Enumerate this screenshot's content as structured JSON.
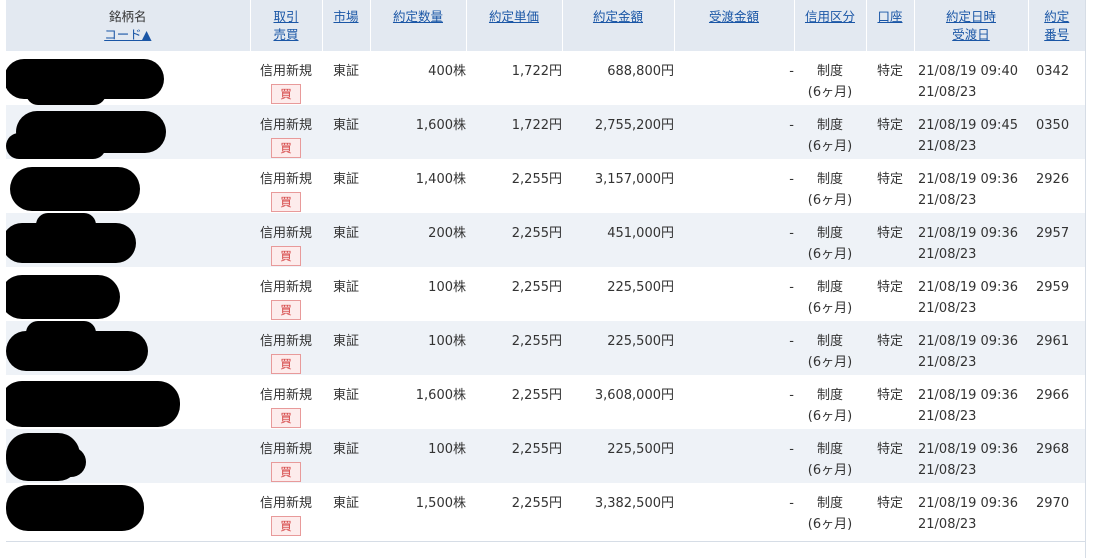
{
  "header": {
    "stock_name": "銘柄名",
    "code_sort": "コード▲",
    "trade_type_1": "取引",
    "trade_type_2": "売買",
    "market": "市場",
    "quantity": "約定数量",
    "unit_price": "約定単価",
    "amount": "約定金額",
    "settlement_amount": "受渡金額",
    "margin_type": "信用区分",
    "account": "口座",
    "datetime_1": "約定日時",
    "datetime_2": "受渡日",
    "order_no_1": "約定",
    "order_no_2": "番号"
  },
  "rows": [
    {
      "trade": "信用新規",
      "side": "買",
      "market": "東証",
      "qty": "400株",
      "price": "1,722円",
      "amount": "688,800円",
      "settle": "-",
      "margin_1": "制度",
      "margin_2": "(6ヶ月)",
      "account": "特定",
      "exec": "21/08/19 09:40",
      "delivery": "21/08/23",
      "no": "0342"
    },
    {
      "trade": "信用新規",
      "side": "買",
      "market": "東証",
      "qty": "1,600株",
      "price": "1,722円",
      "amount": "2,755,200円",
      "settle": "-",
      "margin_1": "制度",
      "margin_2": "(6ヶ月)",
      "account": "特定",
      "exec": "21/08/19 09:45",
      "delivery": "21/08/23",
      "no": "0350"
    },
    {
      "trade": "信用新規",
      "side": "買",
      "market": "東証",
      "qty": "1,400株",
      "price": "2,255円",
      "amount": "3,157,000円",
      "settle": "-",
      "margin_1": "制度",
      "margin_2": "(6ヶ月)",
      "account": "特定",
      "exec": "21/08/19 09:36",
      "delivery": "21/08/23",
      "no": "2926"
    },
    {
      "trade": "信用新規",
      "side": "買",
      "market": "東証",
      "qty": "200株",
      "price": "2,255円",
      "amount": "451,000円",
      "settle": "-",
      "margin_1": "制度",
      "margin_2": "(6ヶ月)",
      "account": "特定",
      "exec": "21/08/19 09:36",
      "delivery": "21/08/23",
      "no": "2957"
    },
    {
      "trade": "信用新規",
      "side": "買",
      "market": "東証",
      "qty": "100株",
      "price": "2,255円",
      "amount": "225,500円",
      "settle": "-",
      "margin_1": "制度",
      "margin_2": "(6ヶ月)",
      "account": "特定",
      "exec": "21/08/19 09:36",
      "delivery": "21/08/23",
      "no": "2959"
    },
    {
      "trade": "信用新規",
      "side": "買",
      "market": "東証",
      "qty": "100株",
      "price": "2,255円",
      "amount": "225,500円",
      "settle": "-",
      "margin_1": "制度",
      "margin_2": "(6ヶ月)",
      "account": "特定",
      "exec": "21/08/19 09:36",
      "delivery": "21/08/23",
      "no": "2961"
    },
    {
      "trade": "信用新規",
      "side": "買",
      "market": "東証",
      "qty": "1,600株",
      "price": "2,255円",
      "amount": "3,608,000円",
      "settle": "-",
      "margin_1": "制度",
      "margin_2": "(6ヶ月)",
      "account": "特定",
      "exec": "21/08/19 09:36",
      "delivery": "21/08/23",
      "no": "2966"
    },
    {
      "trade": "信用新規",
      "side": "買",
      "market": "東証",
      "qty": "100株",
      "price": "2,255円",
      "amount": "225,500円",
      "settle": "-",
      "margin_1": "制度",
      "margin_2": "(6ヶ月)",
      "account": "特定",
      "exec": "21/08/19 09:36",
      "delivery": "21/08/23",
      "no": "2968"
    },
    {
      "trade": "信用新規",
      "side": "買",
      "market": "東証",
      "qty": "1,500株",
      "price": "2,255円",
      "amount": "3,382,500円",
      "settle": "-",
      "margin_1": "制度",
      "margin_2": "(6ヶ月)",
      "account": "特定",
      "exec": "21/08/19 09:36",
      "delivery": "21/08/23",
      "no": "2970"
    }
  ],
  "colors": {
    "header_bg": "#e3e9f1",
    "row_alt_bg": "#eef2f7",
    "link": "#1a56a6",
    "buy_badge": "#d23c3c"
  }
}
